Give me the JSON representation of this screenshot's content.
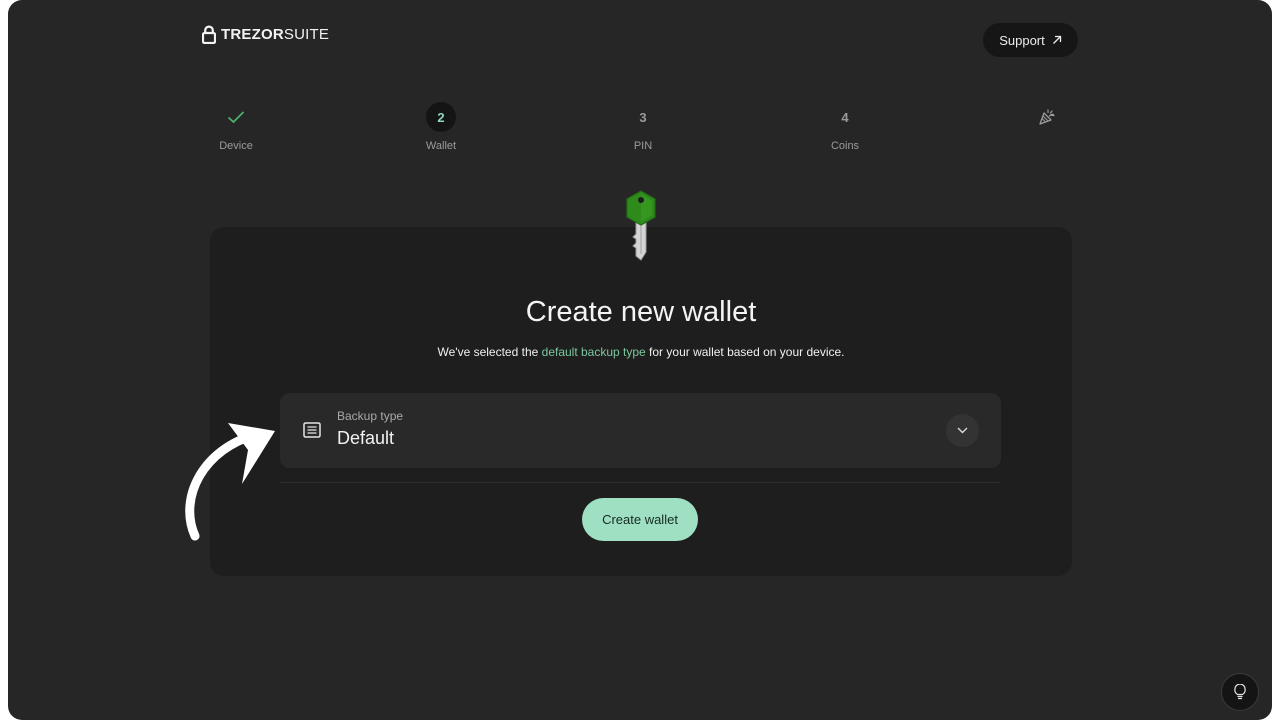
{
  "header": {
    "logo": {
      "brand": "TREZOR",
      "suite": "SUITE",
      "icon": "padlock-logo-icon"
    },
    "support_button": {
      "label": "Support",
      "icon": "external-arrow-icon"
    }
  },
  "steps": [
    {
      "label": "Device",
      "marker": "",
      "state": "done",
      "icon": "check-icon"
    },
    {
      "label": "Wallet",
      "marker": "2",
      "state": "active"
    },
    {
      "label": "PIN",
      "marker": "3",
      "state": "pending"
    },
    {
      "label": "Coins",
      "marker": "4",
      "state": "pending"
    },
    {
      "label": "",
      "marker": "",
      "state": "pending",
      "icon": "party-popper-icon"
    }
  ],
  "main": {
    "icon": "key-icon",
    "title": "Create new wallet",
    "subtitle": {
      "before": "We've selected the ",
      "link": "default backup type",
      "after": " for your wallet based on your device."
    },
    "backup": {
      "label": "Backup type",
      "value": "Default",
      "icon": "document-icon",
      "toggle_icon": "chevron-down-icon"
    },
    "create_button": "Create wallet"
  },
  "overlay": {
    "annotation": "curved-arrow-icon"
  },
  "help_button": {
    "icon": "lightbulb-icon"
  },
  "colors": {
    "background": "#262626",
    "card": "#1e1e1e",
    "accent": "#9fe0c3",
    "link": "#7cc79e",
    "check": "#4caf6a",
    "key_green": "#2f8a1c"
  }
}
